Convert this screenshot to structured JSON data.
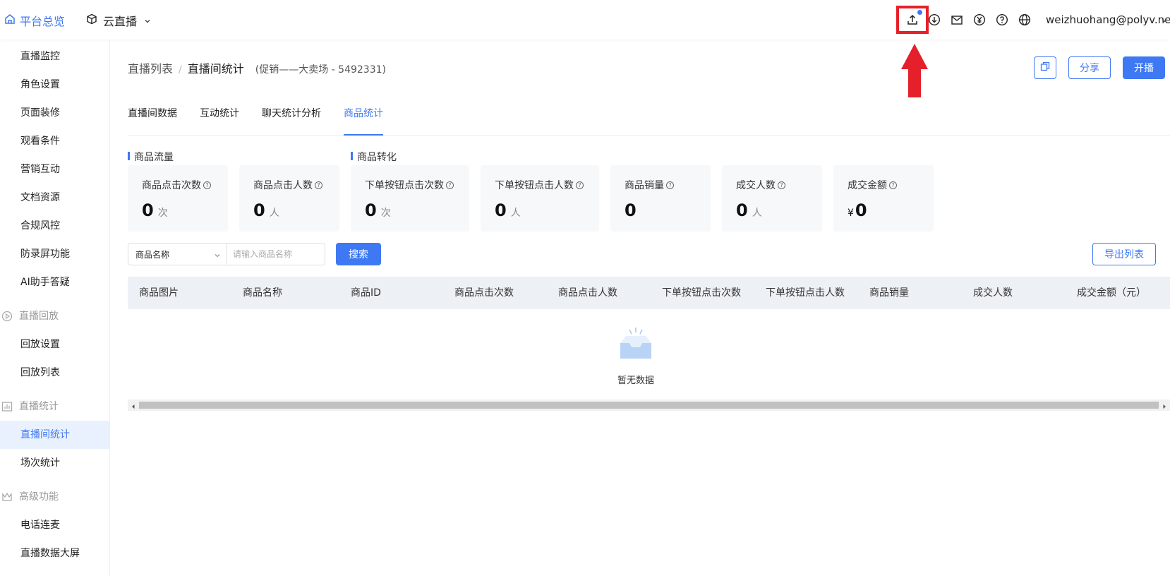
{
  "topbar": {
    "home_label": "平台总览",
    "product_label": "云直播",
    "user_email": "weizhuohang@polyv.net",
    "icons": [
      "upload-icon",
      "download-icon",
      "mail-icon",
      "yen-icon",
      "help-icon",
      "globe-icon"
    ]
  },
  "sidebar": {
    "items": [
      {
        "label": "直播监控"
      },
      {
        "label": "角色设置"
      },
      {
        "label": "页面装修"
      },
      {
        "label": "观看条件"
      },
      {
        "label": "营销互动"
      },
      {
        "label": "文档资源"
      },
      {
        "label": "合规风控"
      },
      {
        "label": "防录屏功能"
      },
      {
        "label": "AI助手答疑"
      }
    ],
    "group_replay": "直播回放",
    "replay_items": [
      {
        "label": "回放设置"
      },
      {
        "label": "回放列表"
      }
    ],
    "group_stats": "直播统计",
    "stats_items": [
      {
        "label": "直播间统计"
      },
      {
        "label": "场次统计"
      }
    ],
    "group_advanced": "高级功能",
    "advanced_items": [
      {
        "label": "电话连麦"
      },
      {
        "label": "直播数据大屏"
      }
    ]
  },
  "breadcrumb": {
    "parent": "直播列表",
    "separator": "/",
    "current": "直播间统计",
    "room": "(促销——大卖场 - 5492331)"
  },
  "actions": {
    "share": "分享",
    "start": "开播"
  },
  "tabs": [
    {
      "label": "直播间数据"
    },
    {
      "label": "互动统计"
    },
    {
      "label": "聊天统计分析"
    },
    {
      "label": "商品统计"
    }
  ],
  "active_tab": "商品统计",
  "sections": {
    "traffic": "商品流量",
    "conversion": "商品转化"
  },
  "metrics": [
    {
      "label": "商品点击次数",
      "value": "0",
      "unit": "次"
    },
    {
      "label": "商品点击人数",
      "value": "0",
      "unit": "人"
    },
    {
      "label": "下单按钮点击次数",
      "value": "0",
      "unit": "次"
    },
    {
      "label": "下单按钮点击人数",
      "value": "0",
      "unit": "人"
    },
    {
      "label": "商品销量",
      "value": "0",
      "unit": ""
    },
    {
      "label": "成交人数",
      "value": "0",
      "unit": "人"
    },
    {
      "label": "成交金额",
      "value": "0",
      "currency": "¥"
    }
  ],
  "help_glyph": "?",
  "filter": {
    "select_value": "商品名称",
    "placeholder": "请输入商品名称",
    "search_label": "搜索",
    "export_label": "导出列表"
  },
  "table": {
    "columns": [
      "商品图片",
      "商品名称",
      "商品ID",
      "商品点击次数",
      "商品点击人数",
      "下单按钮点击次数",
      "下单按钮点击人数",
      "商品销量",
      "成交人数",
      "成交金额（元）"
    ],
    "rows": [],
    "empty_text": "暂无数据"
  },
  "colors": {
    "accent": "#3e78f3",
    "highlight": "#e5202a"
  }
}
